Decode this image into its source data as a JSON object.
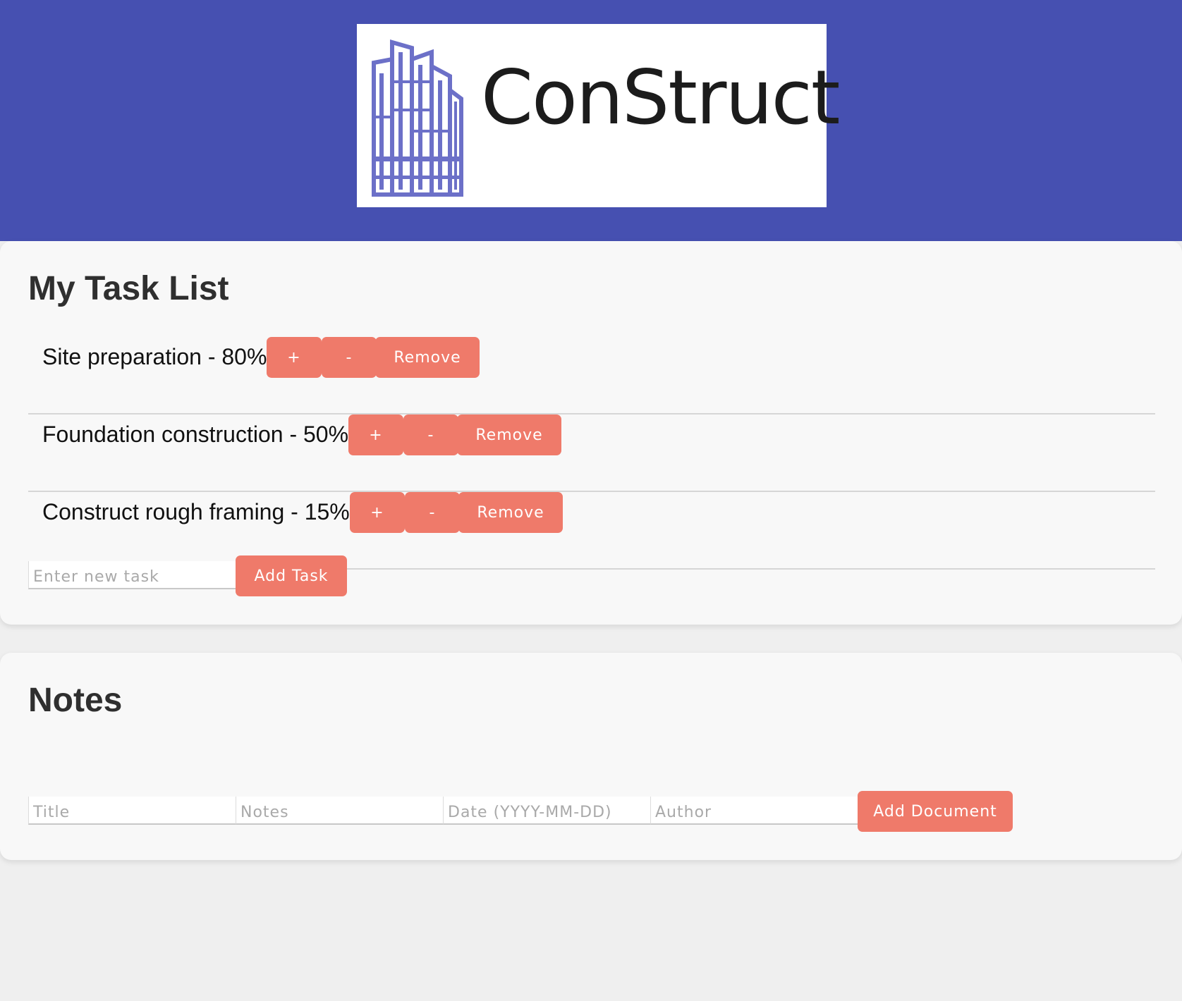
{
  "header": {
    "logo_text": "ConStruct",
    "logo_icon": "building-icon",
    "background_color": "#4650b1"
  },
  "tasks": {
    "title": "My Task List",
    "items": [
      {
        "label": "Site preparation - 80%",
        "inc_label": "+",
        "dec_label": "-",
        "remove_label": "Remove"
      },
      {
        "label": "Foundation construction - 50%",
        "inc_label": "+",
        "dec_label": "-",
        "remove_label": "Remove"
      },
      {
        "label": "Construct rough framing - 15%",
        "inc_label": "+",
        "dec_label": "-",
        "remove_label": "Remove"
      }
    ],
    "new_task_placeholder": "Enter new task",
    "new_task_value": "",
    "add_label": "Add Task"
  },
  "notes": {
    "title": "Notes",
    "title_placeholder": "Title",
    "notes_placeholder": "Notes",
    "date_placeholder": "Date (YYYY-MM-DD)",
    "author_placeholder": "Author",
    "add_label": "Add Document"
  },
  "colors": {
    "accent": "#ef7a6a",
    "card_background": "#f8f8f8",
    "page_background": "#efefef"
  }
}
